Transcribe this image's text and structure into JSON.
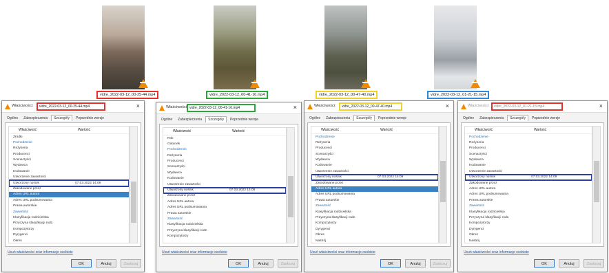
{
  "colors": {
    "red": "#e0312a",
    "green": "#2aa838",
    "yellow": "#f0d22a",
    "blue": "#2c8ad8",
    "navy": "#2b3f9e"
  },
  "files": [
    {
      "label": "vidre_2022-03-12_00-25-44.mp4",
      "title_label": "vidre_2022-03-12_00-25-44.mp4",
      "date": "07.03.2022 14:09"
    },
    {
      "label": "vidre_2022-03-12_00-41-16.mp4",
      "title_label": "vidre_2022-03-12_00-41-16.mp4",
      "date": "07.03.2022 14:09"
    },
    {
      "label": "vidre_2022-03-12_00-47-40.mp4",
      "title_label": "vidre_2022-03-12_00-47-40.mp4",
      "date": "07.03.2022 14:09"
    },
    {
      "label": "vidre_2022-03-12_01-21-15.mp4",
      "title_label": "vidre_2022-03-12_01-21-15.mp4",
      "date": "07.03.2022 14:09"
    }
  ],
  "window": {
    "title_prefix": "Właściwości:",
    "tabs": [
      "Ogólne",
      "Zabezpieczenia",
      "Szczegóły",
      "Poprzednie wersje"
    ],
    "col_property": "Właściwość",
    "col_value": "Wartość",
    "footer_link": "Usuń właściwości oraz informacje osobiste",
    "btn_ok": "OK",
    "btn_cancel": "Anuluj",
    "btn_apply": "Zastosuj"
  },
  "rows_w1": [
    "Źródło",
    "Pochodzenie",
    "Reżyseria",
    "Producenci",
    "Scenarzyści",
    "Wydawca",
    "Kodowanie",
    "Utworzenie zawartości",
    "Utworzony nośnik",
    "Zakodowane przez",
    "Adres URL autora",
    "Adres URL podsumowania",
    "Prawa autorskie",
    "Zawartość",
    "Klasyfikacja rodzicielska",
    "Przyczyna klasyfikacji rodz.",
    "Kompozytorzy",
    "Dyrygenci",
    "Okres"
  ],
  "rows_w2": [
    "Rok",
    "Gatunek",
    "Pochodzenie",
    "Reżyseria",
    "Producenci",
    "Scenarzyści",
    "Wydawca",
    "Kodowanie",
    "Utworzenie zawartości",
    "Utworzony nośnik",
    "Zakodowane przez",
    "Adres URL autora",
    "Adres URL podsumowania",
    "Prawa autorskie",
    "Zawartość",
    "Klasyfikacja rodzicielska",
    "Przyczyna klasyfikacji rodz.",
    "Kompozytorzy"
  ],
  "rows_w3": [
    "Pochodzenie",
    "Reżyseria",
    "Producenci",
    "Scenarzyści",
    "Wydawca",
    "Kodowanie",
    "Utworzenie zawartości",
    "Utworzony nośnik",
    "Zakodowane przez",
    "Adres URL autora",
    "Adres URL podsumowania",
    "Prawa autorskie",
    "Zawartość",
    "Klasyfikacja rodzicielska",
    "Przyczyna klasyfikacji rodz.",
    "Kompozytorzy",
    "Dyrygenci",
    "Okres",
    "Nastrój"
  ],
  "rows_w4": [
    "Pochodzenie",
    "Reżyseria",
    "Producenci",
    "Scenarzyści",
    "Wydawca",
    "Kodowanie",
    "Utworzenie zawartości",
    "Utworzony nośnik",
    "Zakodowane przez",
    "Adres URL autora",
    "Adres URL podsumowania",
    "Prawa autorskie",
    "Zawartość",
    "Klasyfikacja rodzicielska",
    "Przyczyna klasyfikacji rodz.",
    "Kompozytorzy",
    "Dyrygenci",
    "Okres",
    "Nastrój"
  ]
}
